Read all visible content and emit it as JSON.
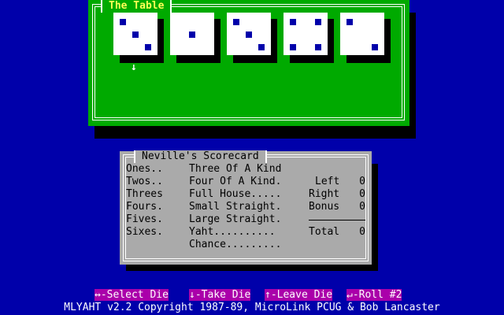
{
  "table": {
    "title": "The Table"
  },
  "dice": [
    {
      "index": 1,
      "value": 3
    },
    {
      "index": 2,
      "value": 1
    },
    {
      "index": 3,
      "value": 3
    },
    {
      "index": 4,
      "value": 4
    },
    {
      "index": 5,
      "value": 2
    }
  ],
  "table_cursor": {
    "glyph": "↓",
    "selected_die": 1
  },
  "scorecard": {
    "title": "Neville's Scorecard",
    "upper": [
      "Ones..",
      "Twos..",
      "Threes",
      "Fours.",
      "Fives.",
      "Sixes."
    ],
    "lower": [
      "Three Of A Kind",
      "Four Of A Kind.",
      "Full House.....",
      "Small Straight.",
      "Large Straight.",
      "Yaht..........",
      "Chance........."
    ],
    "totals": {
      "left_label": "Left",
      "left_value": "0",
      "right_label": "Right",
      "right_value": "0",
      "bonus_label": "Bonus",
      "bonus_value": "0",
      "total_label": "Total",
      "total_value": "0"
    }
  },
  "help": {
    "select": "↔-Select Die",
    "take": "↓-Take Die",
    "leave": "↑-Leave Die",
    "roll": "↵-Roll #2"
  },
  "footer": {
    "copyright": "MLYAHT v2.2 Copyright 1987-89, MicroLink PCUG & Bob Lancaster"
  },
  "colors": {
    "background": "#0000aa",
    "table_green": "#00aa00",
    "scorecard_gray": "#aaaaaa",
    "title_yellow": "#ffff55",
    "key_magenta": "#aa00aa",
    "pip_blue": "#0000aa"
  }
}
